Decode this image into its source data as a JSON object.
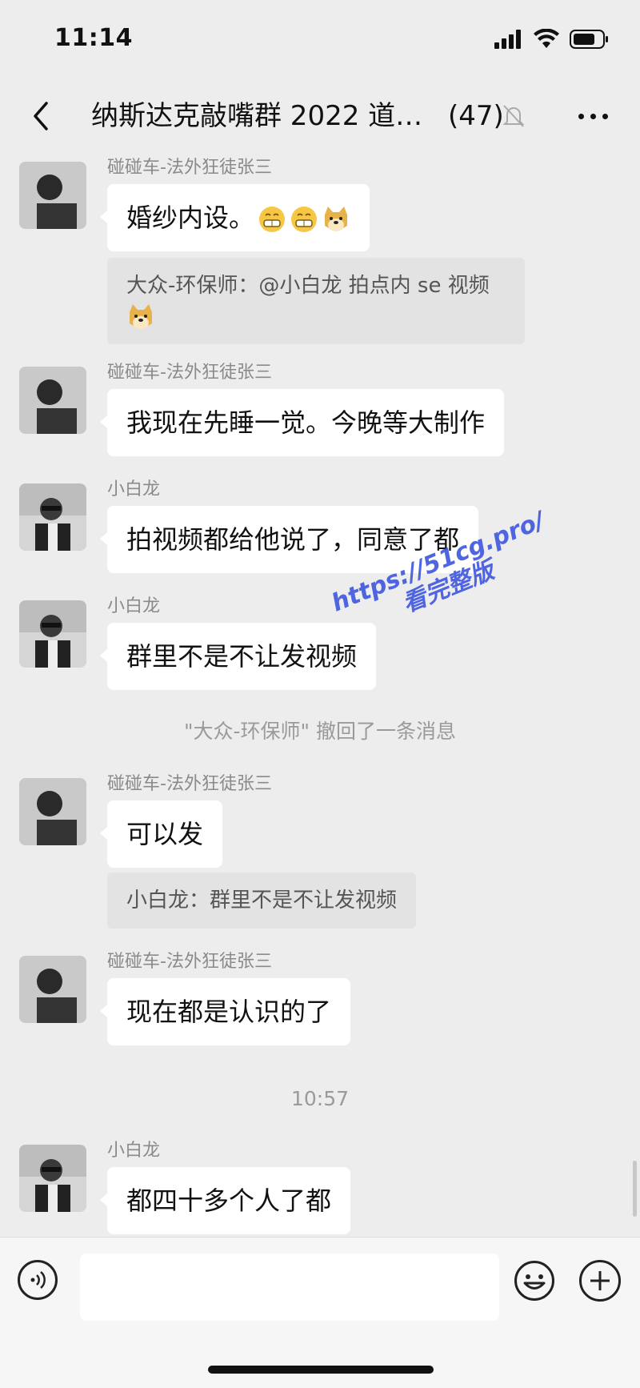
{
  "status": {
    "time": "11:14"
  },
  "nav": {
    "title": "纳斯达克敲嘴群 2022 道…",
    "member_count": "(47)"
  },
  "messages": [
    {
      "sender": "碰碰车-法外狂徒张三",
      "text": "婚纱内设。",
      "emojis": [
        "grimace-emoji",
        "grimace-emoji",
        "doge-emoji"
      ],
      "quote": "大众-环保师：@小白龙 拍点内 se 视频"
    },
    {
      "sender": "碰碰车-法外狂徒张三",
      "text": "我现在先睡一觉。今晚等大制作"
    },
    {
      "sender": "小白龙",
      "text": "拍视频都给他说了，同意了都"
    },
    {
      "sender": "小白龙",
      "text": "群里不是不让发视频"
    },
    {
      "system": "\"大众-环保师\" 撤回了一条消息"
    },
    {
      "sender": "碰碰车-法外狂徒张三",
      "text": "可以发",
      "quote": "小白龙：群里不是不让发视频"
    },
    {
      "sender": "碰碰车-法外狂徒张三",
      "text": "现在都是认识的了"
    },
    {
      "time": "10:57"
    },
    {
      "sender": "小白龙",
      "text": "都四十多个人了都"
    }
  ],
  "watermark": {
    "line1": "https://51cg.pro/",
    "line2": "看完整版"
  },
  "colors": {
    "background": "#ededed",
    "bubble": "#ffffff",
    "watermark": "#3d56e0"
  }
}
